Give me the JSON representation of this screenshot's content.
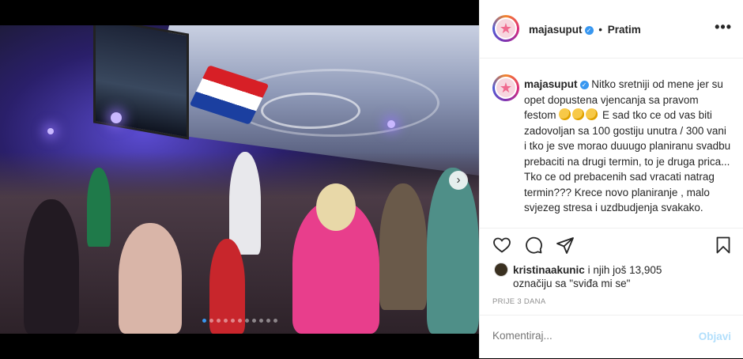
{
  "post": {
    "carousel": {
      "slide_count": 11,
      "active_index": 0
    },
    "author": {
      "username": "majasuput",
      "follow_label": "Pratim"
    },
    "caption": {
      "username": "majasuput",
      "text_1": "Nitko sretniji od mene jer su opet dopustena vjencanja sa pravom festom",
      "emoji_name": "partying-face",
      "text_2": "E sad tko ce od vas biti zadovoljan sa 100 gostiju unutra / 300 vani i tko je sve morao duuugo planiranu svadbu prebaciti na drugi termin, to je druga prica... Tko ce od prebacenih sad vracati natrag termin??? Krece novo planiranje , malo svjezeg stresa i uzdbudjenja svakako."
    },
    "likes": {
      "first_user": "kristinaakunic",
      "others_text": "i njih još 13,905",
      "line2": "označiju sa \"sviđa mi se\""
    },
    "time_label": "PRIJE 3 DANA",
    "comment": {
      "placeholder": "Komentiraj...",
      "post_label": "Objavi"
    }
  },
  "colors": {
    "accent": "#3897f0",
    "post_disabled": "#b2dffc",
    "text": "#262626",
    "muted": "#8e8e8e"
  }
}
